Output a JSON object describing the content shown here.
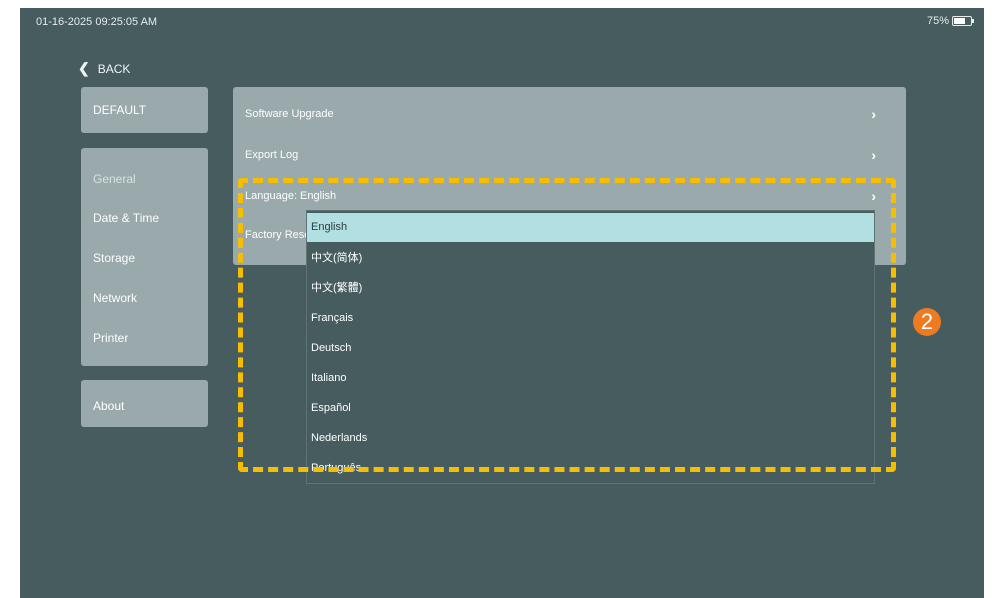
{
  "status": {
    "datetime": "01-16-2025 09:25:05 AM",
    "battery": "75%",
    "battery_level": 0.75
  },
  "back": {
    "label": "BACK"
  },
  "default_label": "DEFAULT",
  "nav": [
    "General",
    "Date & Time",
    "Storage",
    "Network",
    "Printer"
  ],
  "about_label": "About",
  "settings": {
    "rows": [
      "Software Upgrade",
      "Export Log",
      "Language:  English",
      "Factory Rese"
    ]
  },
  "language_dropdown": {
    "selected": "English",
    "options": [
      "English",
      "中文(简体)",
      "中文(繁體)",
      "Français",
      "Deutsch",
      "Italiano",
      "Español",
      "Nederlands",
      "Português"
    ]
  },
  "annotation": {
    "badge": "2",
    "highlight_color": "#f7bd00",
    "badge_color": "#ee7a22"
  }
}
